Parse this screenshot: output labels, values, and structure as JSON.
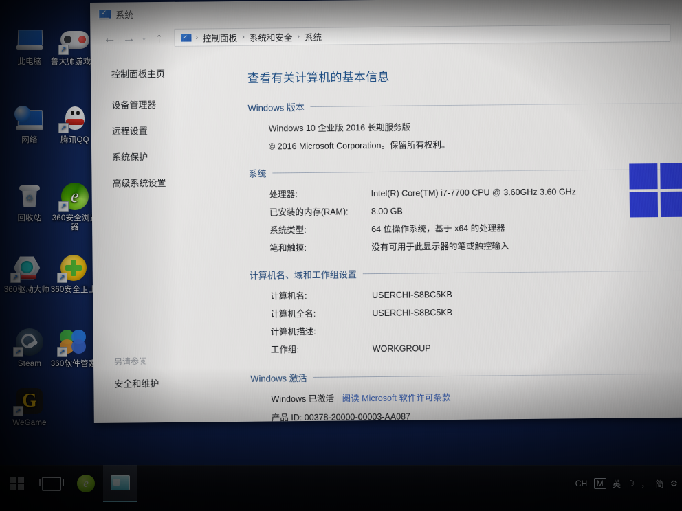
{
  "desktop": {
    "icons": [
      {
        "label": "此电脑",
        "icon": "this-pc-icon",
        "shortcut": false
      },
      {
        "label": "鲁大师游戏库",
        "icon": "gamepad-icon",
        "shortcut": true
      },
      {
        "label": "网络",
        "icon": "network-icon",
        "shortcut": false
      },
      {
        "label": "腾讯QQ",
        "icon": "qq-penguin-icon",
        "shortcut": true
      },
      {
        "label": "回收站",
        "icon": "recycle-bin-icon",
        "shortcut": false
      },
      {
        "label": "360安全浏览器",
        "icon": "360-browser-icon",
        "shortcut": true
      },
      {
        "label": "360驱动大师",
        "icon": "360-driver-icon",
        "shortcut": true
      },
      {
        "label": "360安全卫士",
        "icon": "360-guard-icon",
        "shortcut": true
      },
      {
        "label": "Steam",
        "icon": "steam-icon",
        "shortcut": true
      },
      {
        "label": "360软件管家",
        "icon": "360-software-manager-icon",
        "shortcut": true
      },
      {
        "label": "WeGame",
        "icon": "wegame-icon",
        "shortcut": true
      }
    ]
  },
  "taskbar": {
    "start_label": "开始",
    "taskview_label": "任务视图",
    "browser_label": "360安全浏览器",
    "system_window_label": "系统",
    "tray": {
      "language_code": "CH",
      "ime_mode": "M",
      "ime_english": "英",
      "moon": "☽",
      "punctuation": "，",
      "simplified": "简",
      "settings": "⚙"
    }
  },
  "window": {
    "title": "系统",
    "title_icon": "system-properties-icon",
    "nav": {
      "back": "←",
      "forward": "→",
      "recent_caret": "⌄",
      "up": "↑"
    },
    "breadcrumb": {
      "icon": "control-panel-icon",
      "items": [
        "控制面板",
        "系统和安全",
        "系统"
      ],
      "separator": "›"
    },
    "sidebar": {
      "home": "控制面板主页",
      "links": [
        "设备管理器",
        "远程设置",
        "系统保护",
        "高级系统设置"
      ],
      "see_also_heading": "另请参阅",
      "see_also_links": [
        "安全和维护"
      ]
    },
    "content": {
      "page_title": "查看有关计算机的基本信息",
      "sections": [
        {
          "heading": "Windows 版本",
          "lines": [
            "Windows 10 企业版 2016 长期服务版",
            "© 2016 Microsoft Corporation。保留所有权利。"
          ]
        },
        {
          "heading": "系统",
          "rows": [
            {
              "key": "处理器:",
              "value": "Intel(R) Core(TM) i7-7700 CPU @ 3.60GHz   3.60 GHz"
            },
            {
              "key": "已安装的内存(RAM):",
              "value": "8.00 GB"
            },
            {
              "key": "系统类型:",
              "value": "64 位操作系统，基于 x64 的处理器"
            },
            {
              "key": "笔和触摸:",
              "value": "没有可用于此显示器的笔或触控输入"
            }
          ]
        },
        {
          "heading": "计算机名、域和工作组设置",
          "rows": [
            {
              "key": "计算机名:",
              "value": "USERCHI-S8BC5KB"
            },
            {
              "key": "计算机全名:",
              "value": "USERCHI-S8BC5KB"
            },
            {
              "key": "计算机描述:",
              "value": ""
            },
            {
              "key": "工作组:",
              "value": "WORKGROUP"
            }
          ]
        },
        {
          "heading": "Windows 激活",
          "activation_status": "Windows 已激活",
          "license_link": "阅读 Microsoft 软件许可条款",
          "product_id": "产品 ID: 00378-20000-00003-AA087"
        }
      ]
    },
    "watermark": "windows-logo-watermark"
  },
  "colors": {
    "link": "#3a5fae",
    "section_heading": "#1a3f70",
    "page_title": "#17477e",
    "windows_logo": "#2433c6",
    "desktop": "#12275b"
  }
}
